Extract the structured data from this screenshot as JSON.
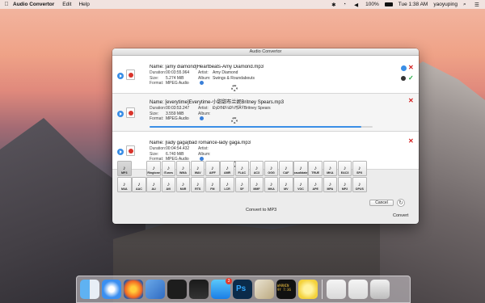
{
  "menubar": {
    "app_name": "Audio Convertor",
    "menus": [
      "Edit",
      "Help"
    ],
    "battery": "100%",
    "clock": "Tue 1:38 AM",
    "user": "yaoyuping"
  },
  "window": {
    "title": "Audio Convertor",
    "labels": {
      "name": "Name:",
      "duration": "Duration:",
      "size": "Size:",
      "format": "Format:",
      "artist": "Artist:",
      "album": "Album:"
    },
    "files": [
      {
        "name": "[amy diamond]Heartbeats-Amy Diamond.mp3",
        "duration": "00:03:55.964",
        "size": "5.274 MiB",
        "format": "MPEG Audio",
        "artist": "Amy Diamond",
        "album": "Swings & Roundabouts",
        "status": "done"
      },
      {
        "name": "[everytime]Everytime-小甜甜布兰妮Britney Spears.mp3",
        "duration": "00:03:53.247",
        "size": "3.559 MiB",
        "format": "MPEG Audio",
        "artist": "Ð¡Ð®Ð¼Ð¼¶ÏÄÝBritney Spears",
        "album": "",
        "status": "converting",
        "progress": 0.95
      },
      {
        "name": "[lady gaga]bad romance-lady gaga.mp3",
        "duration": "00:04:54.432",
        "size": "6.740 MiB",
        "format": "MPEG Audio",
        "artist": "",
        "album": "",
        "status": "queued"
      }
    ],
    "formats_row1": [
      "MP3",
      "",
      "Ringtone",
      "iTunes",
      "WMA",
      "WAV",
      "AIFF",
      "AMR",
      "FLAC",
      "AC3",
      "OGG",
      "CAF",
      "caudidate",
      "TRUE",
      "MKA",
      "EAC3",
      "SPX",
      ""
    ],
    "formats_row2": [
      "M4A",
      "AAC",
      "AU",
      "AVI",
      "M4R",
      "RTS",
      "FM",
      "LCR",
      "SF",
      "MMF",
      "MKA",
      "MV",
      "VOC",
      "APE",
      "MPA",
      "MP2",
      "OPUS",
      ""
    ],
    "selected_format": "MP3",
    "convert_to_label": "Convert to MP3",
    "cancel_label": "Cancel",
    "convert_label": "Convert",
    "colors": {
      "accent": "#3a8ee6",
      "delete": "#d21d1d",
      "done": "#1ba83c"
    }
  },
  "dock": {
    "items": [
      "finder-icon",
      "safari-icon",
      "firefox-icon",
      "xcode-icon",
      "terminal-icon",
      "activity-monitor-icon",
      "app-store-icon",
      "photoshop-icon",
      "preview-icon",
      "console-icon",
      "audio-convertor-icon",
      "screenshot-icon",
      "screenshot-icon",
      "trash-icon"
    ],
    "app_store_badge": "3",
    "console_text": "WARNIN\n9Y 7:36"
  }
}
